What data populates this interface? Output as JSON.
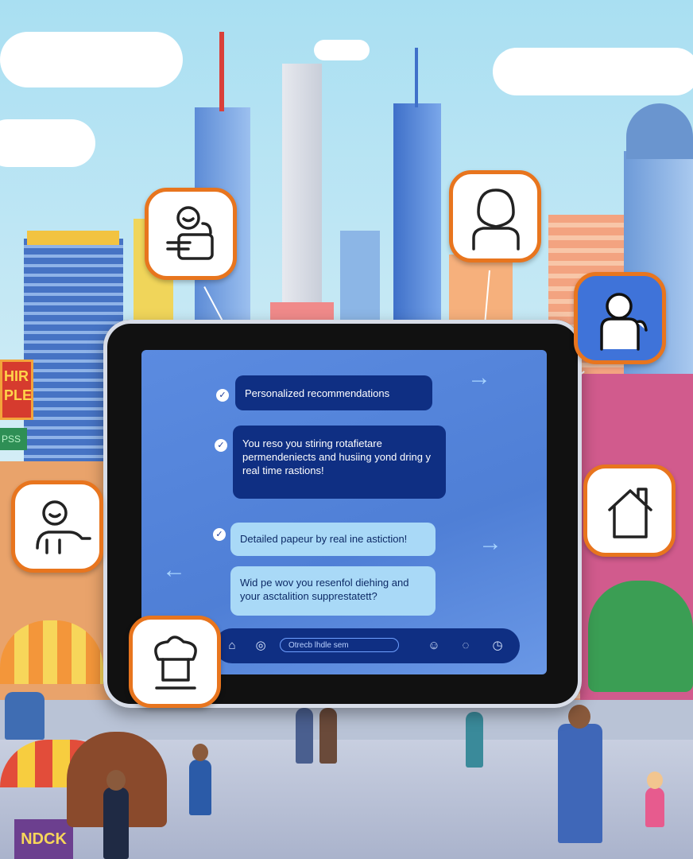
{
  "chat": {
    "messages": [
      {
        "text": "Personalized recommendations",
        "style": "dark"
      },
      {
        "text": "You reso you stiring rotafietare permendeniects and husiing yond dring y real time rastions!",
        "style": "dark"
      },
      {
        "text": "Detailed papeur by real ine astiction!",
        "style": "light"
      },
      {
        "text": "Wid pe wov you resenfol diehing and your asctalition supprestatett?",
        "style": "light"
      }
    ]
  },
  "navbar": {
    "search_text": "Otrecb lhdle sem",
    "icons": [
      "home-icon",
      "globe-icon",
      "search-icon",
      "user-icon",
      "chat-icon",
      "clock-icon"
    ]
  },
  "floating_icons": [
    "person-reading-icon",
    "user-profile-icon",
    "person-waving-icon",
    "person-pointing-icon",
    "house-icon",
    "chef-hat-icon"
  ],
  "signs": {
    "left_sign": "HIR\nPLE",
    "left_small_sign": "PSS",
    "kiosk_sign": "NDCK"
  },
  "colors": {
    "accent_orange": "#e8751e",
    "bubble_dark": "#0f2f83",
    "bubble_light": "#a9d9f7",
    "screen_blue": "#4f7fd6"
  }
}
